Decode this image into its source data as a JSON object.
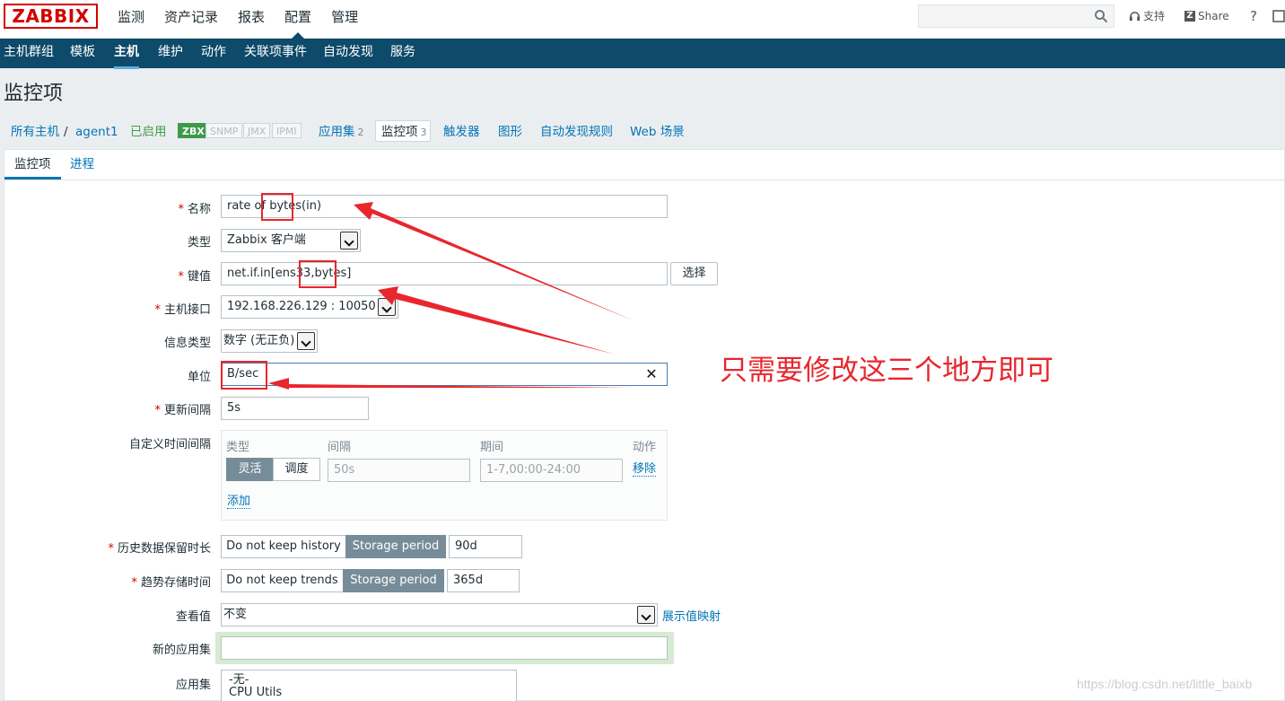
{
  "logo": "ZABBIX",
  "topnav": [
    "监测",
    "资产记录",
    "报表",
    "配置",
    "管理"
  ],
  "topnav_active": "配置",
  "search_value": "",
  "support_label": "支持",
  "share_label": "Share",
  "help_label": "?",
  "subnav": [
    "主机群组",
    "模板",
    "主机",
    "维护",
    "动作",
    "关联项事件",
    "自动发现",
    "服务"
  ],
  "subnav_active": "主机",
  "page_title": "监控项",
  "breadcrumb": {
    "all_hosts": "所有主机",
    "sep": "/",
    "host": "agent1",
    "status": "已启用",
    "tags": [
      "ZBX",
      "SNMP",
      "JMX",
      "IPMI"
    ],
    "apps": "应用集",
    "apps_count": "2",
    "items": "监控项",
    "items_count": "3",
    "triggers": "触发器",
    "graphs": "图形",
    "discovery": "自动发现规则",
    "web": "Web 场景"
  },
  "tabs": [
    "监控项",
    "进程"
  ],
  "form": {
    "name_label": "名称",
    "name_value": "rate of bytes(in)",
    "type_label": "类型",
    "type_value": "Zabbix 客户端",
    "key_label": "键值",
    "key_value": "net.if.in[ens33,bytes]",
    "key_button": "选择",
    "iface_label": "主机接口",
    "iface_value": "192.168.226.129 : 10050",
    "info_label": "信息类型",
    "info_value": "数字 (无正负)",
    "unit_label": "单位",
    "unit_value": "B/sec",
    "unit_clear": "✕",
    "interval_label": "更新间隔",
    "interval_value": "5s",
    "custom_label": "自定义时间间隔",
    "custom": {
      "col_type": "类型",
      "col_interval": "间隔",
      "col_period": "期间",
      "col_action": "动作",
      "flex": "灵活",
      "sched": "调度",
      "interval_ph": "50s",
      "period_ph": "1-7,00:00-24:00",
      "remove": "移除",
      "add": "添加"
    },
    "history_label": "历史数据保留时长",
    "history_opt1": "Do not keep history",
    "history_opt2": "Storage period",
    "history_value": "90d",
    "trends_label": "趋势存储时间",
    "trends_opt1": "Do not keep trends",
    "trends_opt2": "Storage period",
    "trends_value": "365d",
    "valuemap_label": "查看值",
    "valuemap_value": "不变",
    "valuemap_link": "展示值映射",
    "newapp_label": "新的应用集",
    "newapp_value": "",
    "apps_label": "应用集",
    "apps_list": [
      "-无-",
      "CPU Utils"
    ]
  },
  "annotation": "只需要修改这三个地方即可",
  "watermark": "https://blog.csdn.net/little_baixb",
  "colors": {
    "header": "#0e4a69",
    "annotation": "#e8262d",
    "link": "#0275b8",
    "enabled": "#3c9a4a"
  }
}
